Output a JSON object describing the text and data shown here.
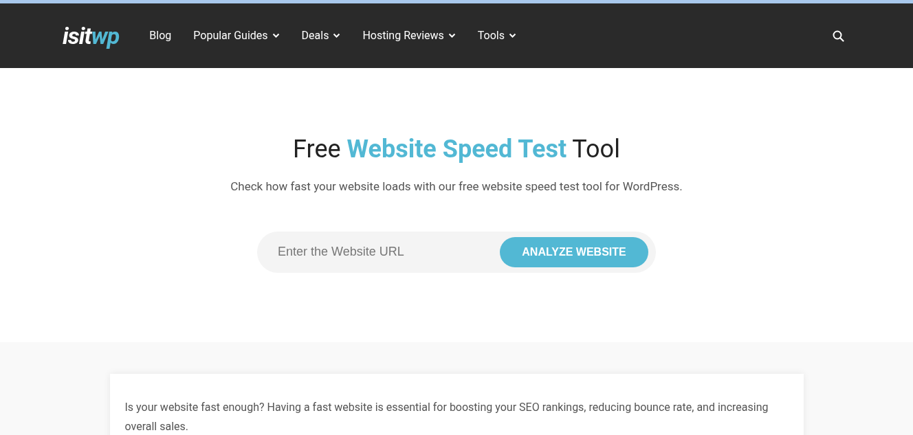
{
  "header": {
    "logo": [
      "isit",
      "wp"
    ],
    "nav": [
      {
        "label": "Blog",
        "has_dropdown": false
      },
      {
        "label": "Popular Guides",
        "has_dropdown": true
      },
      {
        "label": "Deals",
        "has_dropdown": true
      },
      {
        "label": "Hosting Reviews",
        "has_dropdown": true
      },
      {
        "label": "Tools",
        "has_dropdown": true
      }
    ]
  },
  "hero": {
    "title": [
      {
        "text": "Free ",
        "highlight": false
      },
      {
        "text": "Website Speed Test",
        "highlight": true
      },
      {
        "text": " Tool",
        "highlight": false
      }
    ],
    "subtitle": "Check how fast your website loads with our free website speed test tool for WordPress.",
    "url_field": {
      "placeholder": "Enter the Website URL"
    },
    "button": "ANALYZE WEBSITE"
  },
  "intro": {
    "text": "Is your website fast enough? Having a fast website is essential for boosting your SEO rankings, reducing bounce rate, and increasing overall sales."
  }
}
